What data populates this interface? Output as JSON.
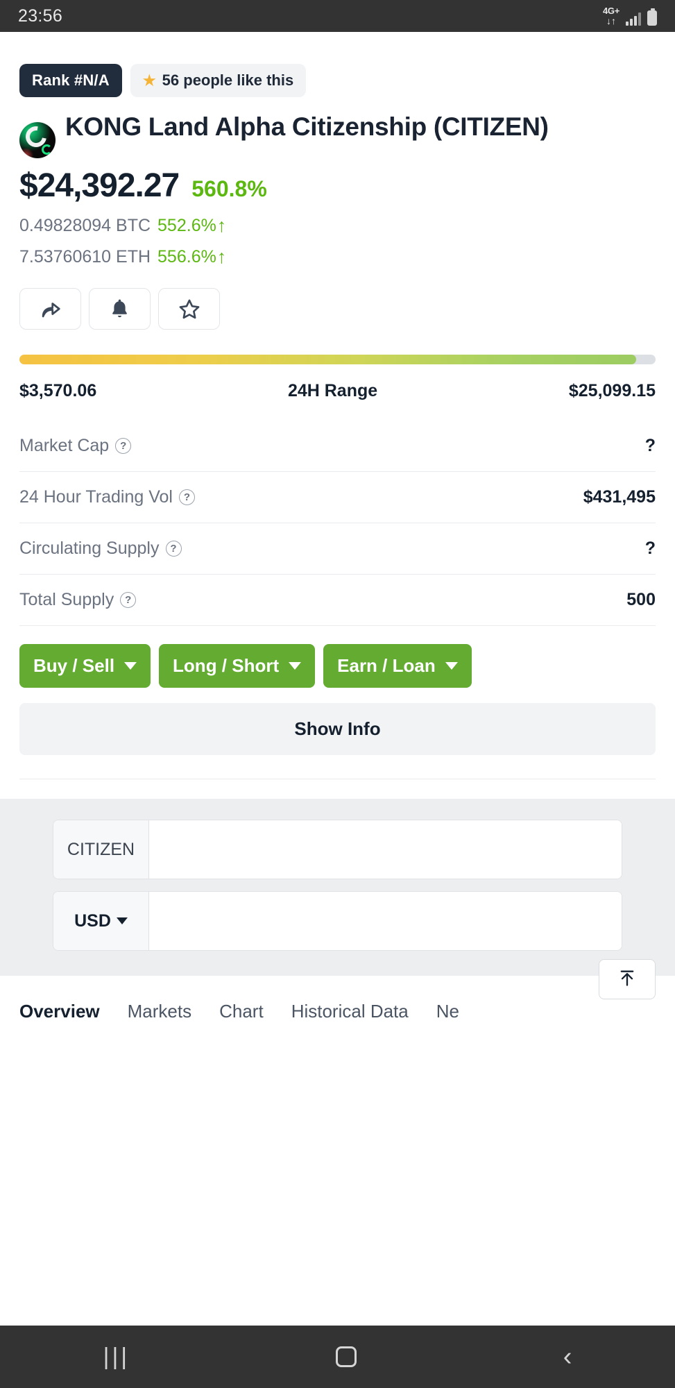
{
  "status_bar": {
    "time": "23:56",
    "network_label": "4G+",
    "network_arrows": "↓↑"
  },
  "header": {
    "rank_badge": "Rank #N/A",
    "likes_badge": "56 people like this",
    "likes_icon": "star-emoji",
    "coin_name": "KONG Land Alpha Citizenship (CITIZEN)",
    "logo_icon": "kong-land-coin-logo"
  },
  "price": {
    "value": "$24,392.27",
    "change_pct": "560.8%",
    "change_color": "#5cb811",
    "btc_amount": "0.49828094 BTC",
    "btc_change": "552.6%",
    "btc_arrow": "↑",
    "eth_amount": "7.53760610 ETH",
    "eth_change": "556.6%",
    "eth_arrow": "↑"
  },
  "action_buttons": [
    {
      "name": "share-button",
      "icon": "share-arrow-icon"
    },
    {
      "name": "alert-button",
      "icon": "bell-icon"
    },
    {
      "name": "favorite-button",
      "icon": "star-outline-icon"
    }
  ],
  "range": {
    "low": "$3,570.06",
    "label": "24H Range",
    "high": "$25,099.15",
    "fill_percent": 97,
    "gradient_start": "#f5c242",
    "gradient_end": "#9ccc62"
  },
  "stats": [
    {
      "label": "Market Cap",
      "value": "?",
      "has_help": true
    },
    {
      "label": "24 Hour Trading Vol",
      "value": "$431,495",
      "has_help": true
    },
    {
      "label": "Circulating Supply",
      "value": "?",
      "has_help": true
    },
    {
      "label": "Total Supply",
      "value": "500",
      "has_help": true
    }
  ],
  "cta_buttons": [
    {
      "label": "Buy / Sell"
    },
    {
      "label": "Long / Short"
    },
    {
      "label": "Earn / Loan"
    }
  ],
  "show_info_label": "Show Info",
  "cta_color": "#64ab32",
  "converter": {
    "from_unit": "CITIZEN",
    "from_value": "",
    "from_placeholder": "",
    "to_unit": "USD",
    "to_value": "",
    "to_placeholder": ""
  },
  "scroll_top_icon": "scroll-to-top-icon",
  "tabs": [
    {
      "label": "Overview",
      "active": true
    },
    {
      "label": "Markets",
      "active": false
    },
    {
      "label": "Chart",
      "active": false
    },
    {
      "label": "Historical Data",
      "active": false
    },
    {
      "label": "Ne",
      "active": false
    }
  ],
  "nav_bar": {
    "recent_icon": "recent-apps-icon",
    "recent_glyph": "|||",
    "home_icon": "home-icon",
    "back_icon": "back-icon",
    "back_glyph": "‹"
  }
}
